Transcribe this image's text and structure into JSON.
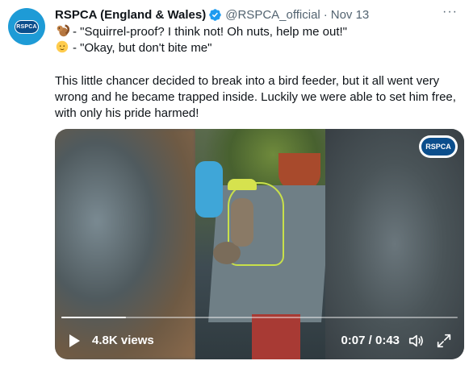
{
  "tweet": {
    "avatar_text": "RSPCA",
    "display_name": "RSPCA (England & Wales)",
    "handle": "@RSPCA_official",
    "separator": "·",
    "date": "Nov 13",
    "more_label": "···",
    "line1": "- \"Squirrel-proof? I think not! Oh nuts, help me out!\"",
    "line2": "- \"Okay, but don't bite me\"",
    "paragraph": "This little chancer decided to break into a bird feeder, but it all went very wrong and he became trapped inside. Luckily we were able to set him free, with only his pride harmed!",
    "emoji1": "squirrel-emoji",
    "emoji2": "baby-emoji"
  },
  "video": {
    "logo_text": "RSPCA",
    "views": "4.8K views",
    "time": "0:07 / 0:43",
    "progress": 0.163
  },
  "colors": {
    "brand_blue": "#1e9bd6",
    "rspca_navy": "#0b4e8c",
    "verified_blue": "#1d9bf0",
    "secondary_text": "#536471"
  }
}
